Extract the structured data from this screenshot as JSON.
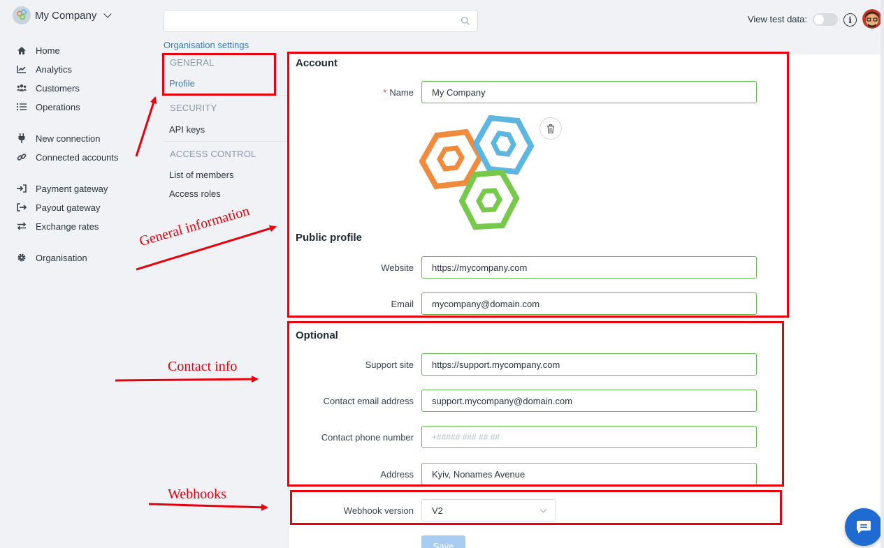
{
  "app": {
    "company_name": "My Company"
  },
  "sidebar": {
    "items": [
      {
        "label": "Home",
        "icon": "home-icon"
      },
      {
        "label": "Analytics",
        "icon": "chart-line-icon"
      },
      {
        "label": "Customers",
        "icon": "users-icon"
      },
      {
        "label": "Operations",
        "icon": "list-icon"
      },
      {
        "label": "New connection",
        "icon": "plug-icon"
      },
      {
        "label": "Connected accounts",
        "icon": "link-icon"
      },
      {
        "label": "Payment gateway",
        "icon": "sign-in-icon"
      },
      {
        "label": "Payout gateway",
        "icon": "sign-out-icon"
      },
      {
        "label": "Exchange rates",
        "icon": "exchange-icon"
      },
      {
        "label": "Organisation",
        "icon": "gear-icon"
      }
    ]
  },
  "topbar": {
    "search_placeholder": "",
    "view_test_label": "View test data:"
  },
  "breadcrumb": "Organisation settings",
  "settings_nav": {
    "general": "GENERAL",
    "profile": "Profile",
    "security": "SECURITY",
    "api_keys": "API keys",
    "access_control": "ACCESS CONTROL",
    "list_of_members": "List of members",
    "access_roles": "Access roles"
  },
  "form": {
    "account_title": "Account",
    "required_mark": "*",
    "name_label": "Name",
    "name_value": "My Company",
    "public_profile_title": "Public profile",
    "website_label": "Website",
    "website_value": "https://mycompany.com",
    "email_label": "Email",
    "email_value": "mycompany@domain.com",
    "optional_title": "Optional",
    "support_label": "Support site",
    "support_value": "https://support.mycompany.com",
    "contact_email_label": "Contact email address",
    "contact_email_value": "support.mycompany@domain.com",
    "phone_label": "Contact phone number",
    "phone_placeholder": "+##### ### ## ##",
    "address_label": "Address",
    "address_value": "Kyiv, Nonames Avenue",
    "webhook_label": "Webhook version",
    "webhook_value": "V2",
    "save_label": "Save"
  },
  "annotations": {
    "general_info": "General information",
    "contact_info": "Contact info",
    "webhooks": "Webhooks"
  },
  "colors": {
    "accent": "#3b7bbf",
    "input_border": "#5cbf4a",
    "annotation": "#e8000b",
    "chat": "#1f6bd1"
  }
}
